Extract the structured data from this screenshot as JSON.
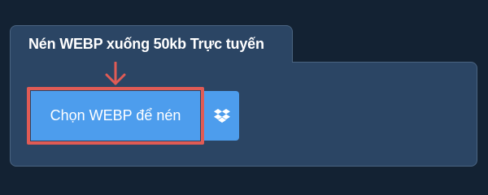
{
  "panel": {
    "title": "Nén WEBP xuống 50kb Trực tuyến"
  },
  "upload": {
    "choose_label": "Chọn WEBP để nén",
    "dropbox_icon": "dropbox-icon"
  },
  "colors": {
    "background": "#132233",
    "panel": "#2b4564",
    "button": "#4d9ded",
    "highlight": "#e05b55"
  }
}
